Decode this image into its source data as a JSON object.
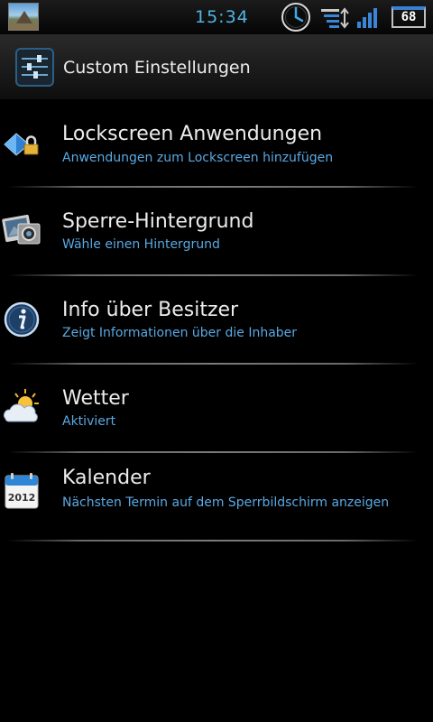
{
  "status_bar": {
    "time": "15:34",
    "battery_level": "68",
    "icons": [
      "notification-thumbnail-icon",
      "alarm-clock-icon",
      "data-sync-icon",
      "signal-strength-icon",
      "battery-icon"
    ]
  },
  "header": {
    "title": "Custom Einstellungen",
    "icon": "settings-sliders-icon"
  },
  "items": [
    {
      "title": "Lockscreen Anwendungen",
      "summary": "Anwendungen zum Lockscreen hinzufügen",
      "icon": "lock-diamond-icon"
    },
    {
      "title": "Sperre-Hintergrund",
      "summary": "Wähle einen Hintergrund",
      "icon": "wallpaper-icon"
    },
    {
      "title": "Info über Besitzer",
      "summary": "Zeigt Informationen über die Inhaber",
      "icon": "info-icon"
    },
    {
      "title": "Wetter",
      "summary": "Aktiviert",
      "icon": "weather-icon"
    },
    {
      "title": "Kalender",
      "summary": "Nächsten Termin auf dem Sperrbildschirm anzeigen",
      "icon": "calendar-icon",
      "icon_text": "2012"
    }
  ],
  "colors": {
    "summary_text": "#5aa9e3",
    "clock_text": "#4fb6e6",
    "background": "#000000"
  }
}
